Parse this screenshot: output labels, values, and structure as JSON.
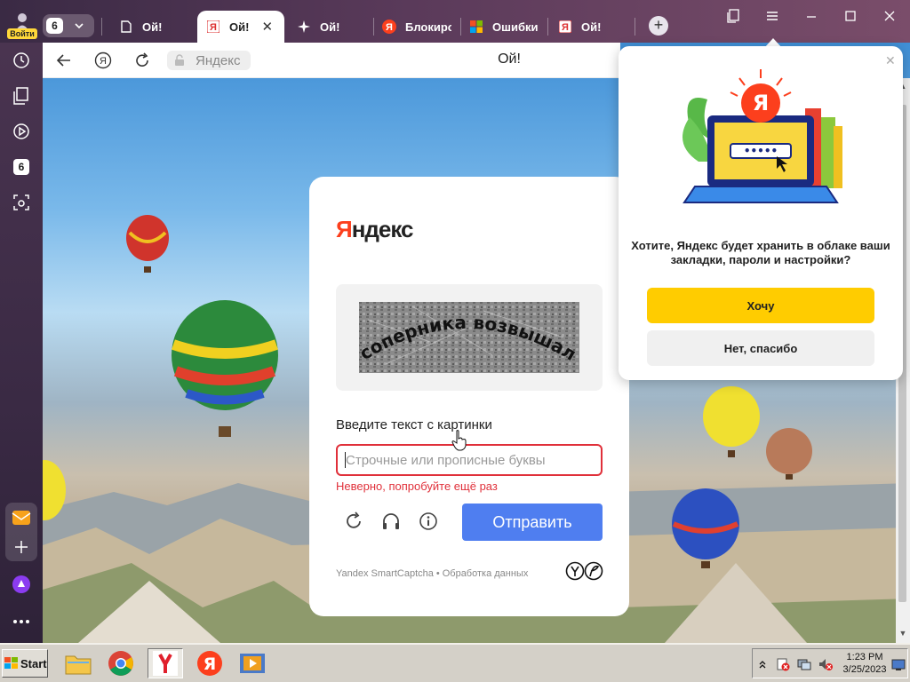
{
  "profile": {
    "login_label": "Войти"
  },
  "tabs_counter": {
    "count": "6"
  },
  "tabs": [
    {
      "label": "Ой!",
      "icon": "page-icon"
    },
    {
      "label": "Ой!",
      "icon": "yandex-icon",
      "active": true
    },
    {
      "label": "Ой!",
      "icon": "sparkle-icon"
    },
    {
      "label": "Блокиро",
      "icon": "yandex-red-icon"
    },
    {
      "label": "Ошибки",
      "icon": "windows-icon"
    },
    {
      "label": "Ой!",
      "icon": "yandex-icon"
    }
  ],
  "sidebar": {
    "badge_count": "6"
  },
  "address_bar": {
    "domain": "Яндекс",
    "page_title": "Ой!"
  },
  "captcha": {
    "logo": {
      "ya": "Я",
      "rest": "ндекс"
    },
    "image_text": "соперника возвышался",
    "prompt": "Введите текст с картинки",
    "input_placeholder": "Строчные или прописные буквы",
    "input_value": "",
    "error": "Неверно, попробуйте ещё раз",
    "submit_label": "Отправить",
    "footer_brand": "Yandex SmartCaptcha",
    "footer_separator": "•",
    "footer_link": "Обработка данных"
  },
  "popup": {
    "text_line1": "Хотите, Яндекс будет хранить в облаке ваши",
    "text_line2": "закладки, пароли и настройки?",
    "yes_label": "Хочу",
    "no_label": "Нет, спасибо",
    "illustration_password": "•••••"
  },
  "taskbar": {
    "start_label": "Start",
    "time": "1:23 PM",
    "date": "3/25/2023"
  },
  "colors": {
    "yandex_red": "#fc3f1d",
    "submit_blue": "#4f7ef0",
    "error_red": "#e0303a",
    "accept_yellow": "#ffcc00"
  }
}
